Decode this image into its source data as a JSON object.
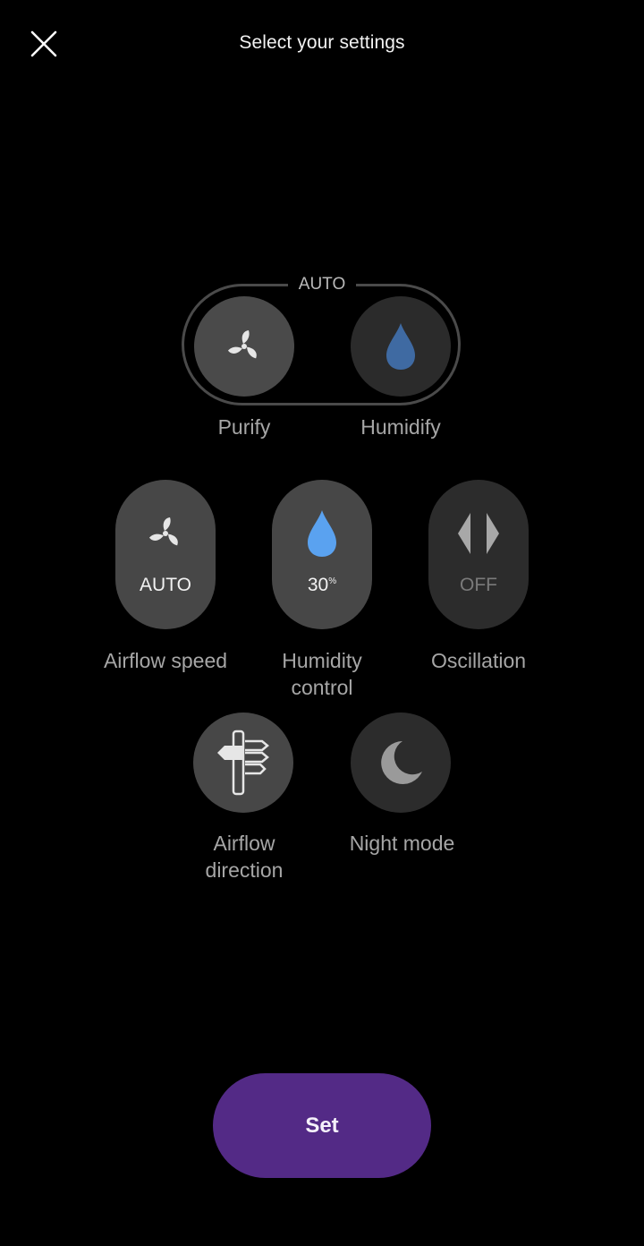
{
  "header": {
    "title": "Select your settings",
    "close_icon": "close-icon"
  },
  "mode_group": {
    "label": "AUTO",
    "purify": {
      "label": "Purify",
      "icon": "fan-icon",
      "selected": true
    },
    "humidify": {
      "label": "Humidify",
      "icon": "water-drop-icon",
      "selected": false
    }
  },
  "controls": {
    "airflow_speed": {
      "label": "Airflow speed",
      "value": "AUTO",
      "icon": "fan-icon"
    },
    "humidity_control": {
      "label_line1": "Humidity",
      "label_line2": "control",
      "value": "30",
      "unit": "%",
      "icon": "water-drop-icon"
    },
    "oscillation": {
      "label": "Oscillation",
      "value": "OFF",
      "icon": "oscillation-icon"
    },
    "airflow_direction": {
      "label_line1": "Airflow",
      "label_line2": "direction",
      "icon": "airflow-direction-icon"
    },
    "night_mode": {
      "label": "Night mode",
      "icon": "moon-icon"
    }
  },
  "actions": {
    "set_label": "Set"
  },
  "colors": {
    "background": "#000000",
    "accent": "#532a86",
    "drop_active": "#5aa2f0",
    "drop_muted": "#3f6aa2"
  }
}
